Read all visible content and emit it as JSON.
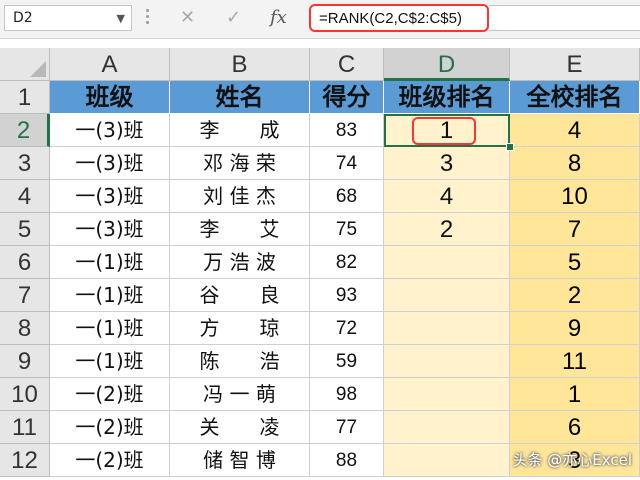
{
  "formula_bar": {
    "name_box": "D2",
    "cancel_icon": "✕",
    "enter_icon": "✓",
    "fx_label": "fx",
    "formula": "=RANK(C2,C$2:C$5)"
  },
  "columns": [
    "A",
    "B",
    "C",
    "D",
    "E"
  ],
  "selected_column": "D",
  "rows": [
    "1",
    "2",
    "3",
    "4",
    "5",
    "6",
    "7",
    "8",
    "9",
    "10",
    "11",
    "12"
  ],
  "selected_row": "2",
  "table": {
    "headers": [
      "班级",
      "姓名",
      "得分",
      "班级排名",
      "全校排名"
    ],
    "records": [
      {
        "class": "一(3)班",
        "name": "李　　成",
        "score": "83",
        "class_rank": "1",
        "school_rank": "4"
      },
      {
        "class": "一(3)班",
        "name": "邓 海 荣",
        "score": "74",
        "class_rank": "3",
        "school_rank": "8"
      },
      {
        "class": "一(3)班",
        "name": "刘 佳 杰",
        "score": "68",
        "class_rank": "4",
        "school_rank": "10"
      },
      {
        "class": "一(3)班",
        "name": "李　　艾",
        "score": "75",
        "class_rank": "2",
        "school_rank": "7"
      },
      {
        "class": "一(1)班",
        "name": "万 浩 波",
        "score": "82",
        "class_rank": "",
        "school_rank": "5"
      },
      {
        "class": "一(1)班",
        "name": "谷　　良",
        "score": "93",
        "class_rank": "",
        "school_rank": "2"
      },
      {
        "class": "一(1)班",
        "name": "方　　琼",
        "score": "72",
        "class_rank": "",
        "school_rank": "9"
      },
      {
        "class": "一(1)班",
        "name": "陈　　浩",
        "score": "59",
        "class_rank": "",
        "school_rank": "11"
      },
      {
        "class": "一(2)班",
        "name": "冯 一 萌",
        "score": "98",
        "class_rank": "",
        "school_rank": "1"
      },
      {
        "class": "一(2)班",
        "name": "关　　凌",
        "score": "77",
        "class_rank": "",
        "school_rank": "6"
      },
      {
        "class": "一(2)班",
        "name": "储 智 博",
        "score": "88",
        "class_rank": "",
        "school_rank": "3"
      }
    ]
  },
  "watermark": "头条 @亦心Excel",
  "colors": {
    "header_fill": "#5b9bd5",
    "class_rank_fill": "#fff2cc",
    "school_rank_fill": "#ffe699",
    "highlight_red": "#ff3333",
    "excel_green": "#217346"
  }
}
